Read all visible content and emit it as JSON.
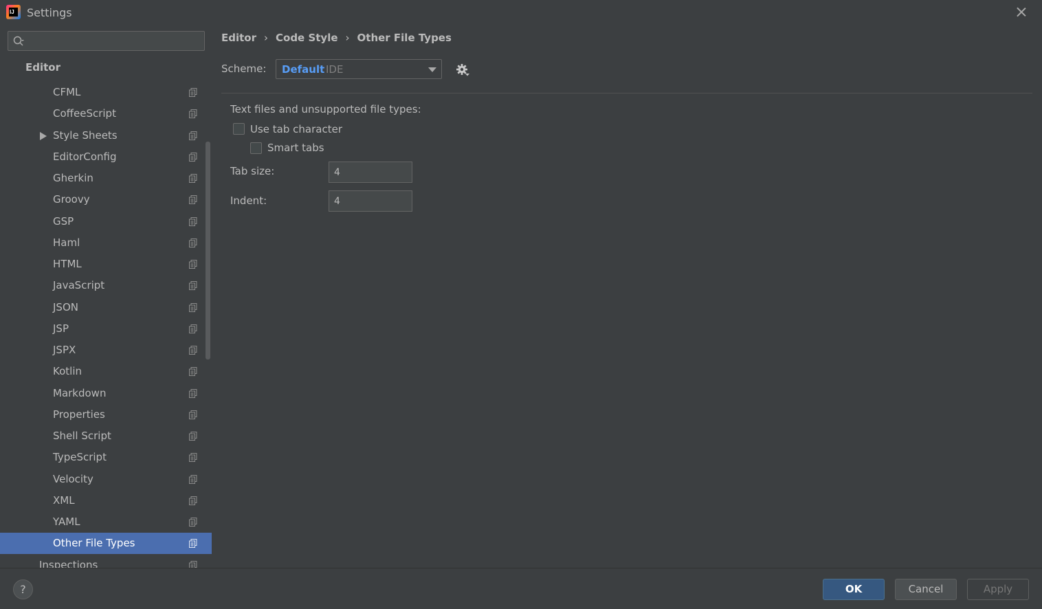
{
  "window": {
    "title": "Settings",
    "icon": "intellij-idea-icon"
  },
  "search": {
    "value": "",
    "placeholder": ""
  },
  "sidebar": {
    "header": "Editor",
    "items": [
      {
        "label": "CFML",
        "expandable": false,
        "selected": false
      },
      {
        "label": "CoffeeScript",
        "expandable": false,
        "selected": false
      },
      {
        "label": "Style Sheets",
        "expandable": true,
        "selected": false
      },
      {
        "label": "EditorConfig",
        "expandable": false,
        "selected": false
      },
      {
        "label": "Gherkin",
        "expandable": false,
        "selected": false
      },
      {
        "label": "Groovy",
        "expandable": false,
        "selected": false
      },
      {
        "label": "GSP",
        "expandable": false,
        "selected": false
      },
      {
        "label": "Haml",
        "expandable": false,
        "selected": false
      },
      {
        "label": "HTML",
        "expandable": false,
        "selected": false
      },
      {
        "label": "JavaScript",
        "expandable": false,
        "selected": false
      },
      {
        "label": "JSON",
        "expandable": false,
        "selected": false
      },
      {
        "label": "JSP",
        "expandable": false,
        "selected": false
      },
      {
        "label": "JSPX",
        "expandable": false,
        "selected": false
      },
      {
        "label": "Kotlin",
        "expandable": false,
        "selected": false
      },
      {
        "label": "Markdown",
        "expandable": false,
        "selected": false
      },
      {
        "label": "Properties",
        "expandable": false,
        "selected": false
      },
      {
        "label": "Shell Script",
        "expandable": false,
        "selected": false
      },
      {
        "label": "TypeScript",
        "expandable": false,
        "selected": false
      },
      {
        "label": "Velocity",
        "expandable": false,
        "selected": false
      },
      {
        "label": "XML",
        "expandable": false,
        "selected": false
      },
      {
        "label": "YAML",
        "expandable": false,
        "selected": false
      },
      {
        "label": "Other File Types",
        "expandable": false,
        "selected": true
      },
      {
        "label": "Inspections",
        "expandable": false,
        "selected": false
      }
    ]
  },
  "breadcrumb": [
    "Editor",
    "Code Style",
    "Other File Types"
  ],
  "breadcrumb_separator": "›",
  "scheme": {
    "label": "Scheme:",
    "name": "Default",
    "kind": "IDE"
  },
  "panel": {
    "section_title": "Text files and unsupported file types:",
    "use_tab_character": {
      "label": "Use tab character",
      "checked": false
    },
    "smart_tabs": {
      "label": "Smart tabs",
      "checked": false
    },
    "tab_size": {
      "label": "Tab size:",
      "value": "4"
    },
    "indent": {
      "label": "Indent:",
      "value": "4"
    }
  },
  "footer": {
    "help_label": "?",
    "ok_label": "OK",
    "cancel_label": "Cancel",
    "apply_label": "Apply"
  },
  "colors": {
    "background": "#3c3f41",
    "selection": "#4b6eaf",
    "accent_link": "#589df6",
    "ok_button": "#365880"
  }
}
